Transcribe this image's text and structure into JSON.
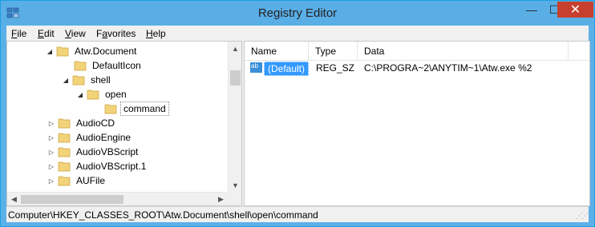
{
  "window": {
    "title": "Registry Editor"
  },
  "title_controls": {
    "minimize": "—",
    "maximize": "☐",
    "close": "✕"
  },
  "menu": [
    {
      "accel": "F",
      "rest": "ile"
    },
    {
      "accel": "E",
      "rest": "dit"
    },
    {
      "accel": "V",
      "rest": "iew"
    },
    {
      "pre": "F",
      "accel": "a",
      "rest": "vorites"
    },
    {
      "accel": "H",
      "rest": "elp"
    }
  ],
  "tree": {
    "items": [
      {
        "label": "Atw.Document",
        "expander": "◢",
        "expanded": true
      },
      {
        "label": "DefaultIcon",
        "expander": "",
        "expanded": false
      },
      {
        "label": "shell",
        "expander": "◢",
        "expanded": true
      },
      {
        "label": "open",
        "expander": "◢",
        "expanded": true
      },
      {
        "label": "command",
        "expander": "",
        "expanded": true,
        "selected": true
      },
      {
        "label": "AudioCD",
        "expander": "▷",
        "expanded": false
      },
      {
        "label": "AudioEngine",
        "expander": "▷",
        "expanded": false
      },
      {
        "label": "AudioVBScript",
        "expander": "▷",
        "expanded": false
      },
      {
        "label": "AudioVBScript.1",
        "expander": "▷",
        "expanded": false
      },
      {
        "label": "AUFile",
        "expander": "▷",
        "expanded": false
      }
    ],
    "scroll_up": "▲",
    "scroll_down": "▼",
    "scroll_left": "◀",
    "scroll_right": "▶"
  },
  "list": {
    "columns": [
      "Name",
      "Type",
      "Data"
    ],
    "rows": [
      {
        "icon": "ab",
        "name": "(Default)",
        "type": "REG_SZ",
        "data": "C:\\PROGRA~2\\ANYTIM~1\\Atw.exe %2"
      }
    ]
  },
  "status": {
    "path": "Computer\\HKEY_CLASSES_ROOT\\Atw.Document\\shell\\open\\command"
  },
  "colors": {
    "titlebar": "#5aaee6",
    "close_button": "#c7402f",
    "selection": "#3399ff",
    "folder": "#e8c15a"
  }
}
